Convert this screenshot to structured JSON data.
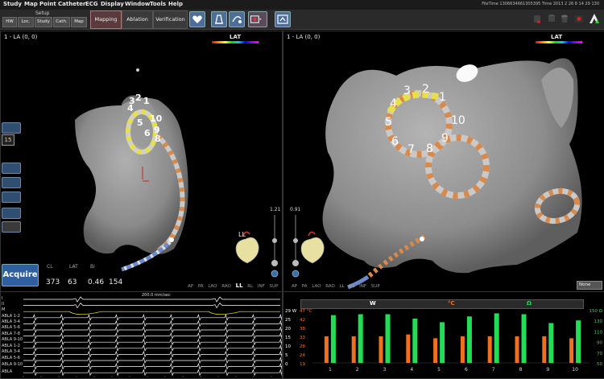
{
  "menu": [
    "Study",
    "Map",
    "Point",
    "Catheter",
    "ECG",
    "Display",
    "Window",
    "Tools",
    "Help"
  ],
  "file_time": "FileTime 1306634661305395 Time 2013 2 26 8 14 29 130",
  "toolbar": {
    "setup_label": "Setup",
    "setup_buttons": [
      "HW",
      "Loc.",
      "Study",
      "Cath.",
      "Map"
    ],
    "modes": [
      "Mapping",
      "Ablation",
      "Verification"
    ],
    "active_mode": "Mapping"
  },
  "left_view": {
    "title": "1 - LA (0, 0)",
    "lat_label": "LAT",
    "zoom": "1.21",
    "orientation_label": "LL",
    "view_buttons": [
      "AP",
      "PA",
      "LAO",
      "RAO",
      "LL",
      "RL",
      "INF",
      "SUP"
    ],
    "electrode_numbers": [
      "3",
      "2",
      "1",
      "4",
      "10",
      "5",
      "9",
      "6",
      "8"
    ],
    "side_value": "15"
  },
  "right_view": {
    "title": "1 - LA (0, 0)",
    "lat_label": "LAT",
    "zoom": "0.91",
    "view_buttons": [
      "AP",
      "PA",
      "LAO",
      "RAO",
      "LL",
      "RL",
      "INF",
      "SUP"
    ],
    "electrode_numbers": [
      "3",
      "2",
      "4",
      "1",
      "5",
      "10",
      "6",
      "7",
      "8",
      "9"
    ],
    "none_select": "None"
  },
  "measurements": {
    "acquire_label": "Acquire",
    "headers": [
      "CL",
      "LAT",
      "Bi",
      ""
    ],
    "values": [
      "373",
      "63",
      "0.46",
      "154"
    ]
  },
  "ecg": {
    "speed": "200.0 mm/sec",
    "channels": [
      "I",
      "II",
      "M",
      "ABLA 1-2",
      "ABLA 3-4",
      "ABLA 5-6",
      "ABLA 7-8",
      "ABLA 9-10",
      "ABLA 1-2",
      "ABLA 3-4",
      "ABLA 5-6",
      "ABLA 9-10",
      "ABLA"
    ],
    "channel_colors": [
      "#ffffff",
      "#ffffff",
      "#ffff00",
      "#ffffff",
      "#ffffff",
      "#ffffff",
      "#ffffff",
      "#ffffff",
      "#ffffff",
      "#ffffff",
      "#ffffff",
      "#ffffff",
      "#ffffff"
    ]
  },
  "chart_data": {
    "type": "bar",
    "categories": [
      "1",
      "2",
      "3",
      "4",
      "5",
      "6",
      "7",
      "8",
      "9",
      "10"
    ],
    "header_labels": [
      "W",
      "°C",
      "Ω"
    ],
    "series": [
      {
        "name": "°C",
        "color": "#f07020",
        "values": [
          33,
          33,
          33,
          34,
          32,
          33,
          33,
          33,
          33,
          32
        ]
      },
      {
        "name": "Ω",
        "color": "#22dd55",
        "values": [
          148,
          150,
          150,
          140,
          132,
          145,
          152,
          150,
          130,
          136
        ]
      }
    ],
    "left_axis_w": [
      "29 W",
      "25",
      "20",
      "15",
      "10",
      "5",
      "0"
    ],
    "left_axis_c": [
      "47 °C",
      "42",
      "38",
      "33",
      "28",
      "24",
      "19"
    ],
    "right_axis_ohm": [
      "150 Ω",
      "130",
      "110",
      "90",
      "70",
      "50"
    ],
    "ylim_ohm": [
      40,
      160
    ],
    "ylim_c": [
      19,
      47
    ]
  },
  "colors": {
    "surface": "#8f8f8f",
    "catheter_orange": "#d98a4a",
    "catheter_gray": "#c9c9c9",
    "electrode_yellow": "#e8e04a",
    "electrode_blue": "#6a8acc",
    "accent_blue": "#2f5f9f"
  }
}
